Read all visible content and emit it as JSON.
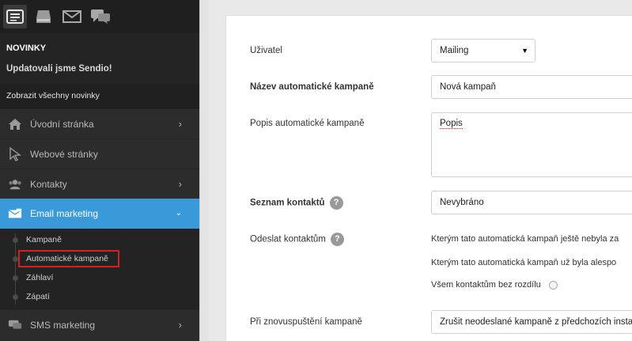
{
  "topbar": {
    "icons": [
      "newspaper-icon",
      "inbox-icon",
      "envelope-icon",
      "chat-bubbles-icon"
    ]
  },
  "news": {
    "heading": "NOVINKY",
    "title": "Updatovali jsme Sendio!",
    "link": "Zobrazit všechny novinky"
  },
  "nav": {
    "items": [
      {
        "label": "Úvodní stránka",
        "icon": "home-icon",
        "chevron": "›"
      },
      {
        "label": "Webové stránky",
        "icon": "cursor-icon",
        "chevron": ""
      },
      {
        "label": "Kontakty",
        "icon": "contacts-icon",
        "chevron": "›"
      },
      {
        "label": "Email marketing",
        "icon": "email-marketing-icon",
        "chevron": "⌄"
      },
      {
        "label": "SMS marketing",
        "icon": "sms-icon",
        "chevron": "›"
      }
    ],
    "sub_items": [
      {
        "label": "Kampaně"
      },
      {
        "label": "Automatické kampaně"
      },
      {
        "label": "Záhlaví"
      },
      {
        "label": "Zápatí"
      }
    ]
  },
  "form": {
    "user": {
      "label": "Uživatel",
      "value": "Mailing",
      "caret": "▼"
    },
    "name": {
      "label": "Název automatické kampaně",
      "value": "Nová kampaň"
    },
    "description": {
      "label": "Popis automatické kampaně",
      "value": "Popis"
    },
    "contact_list": {
      "label": "Seznam kontaktů",
      "value": "Nevybráno",
      "help": "?"
    },
    "send_to": {
      "label": "Odeslat kontaktům",
      "help": "?",
      "options": [
        "Kterým tato automatická kampaň ještě nebyla za",
        "Kterým tato automatická kampaň už byla alespo",
        "Všem kontaktům bez rozdílu"
      ]
    },
    "restart": {
      "label": "Při znovuspuštění kampaně",
      "value": "Zrušit neodeslané kampaně z předchozích insta"
    }
  },
  "colors": {
    "sidebar_bg": "#2c2c2c",
    "active_blue": "#3a9ad9",
    "highlight_red": "#d62020"
  }
}
